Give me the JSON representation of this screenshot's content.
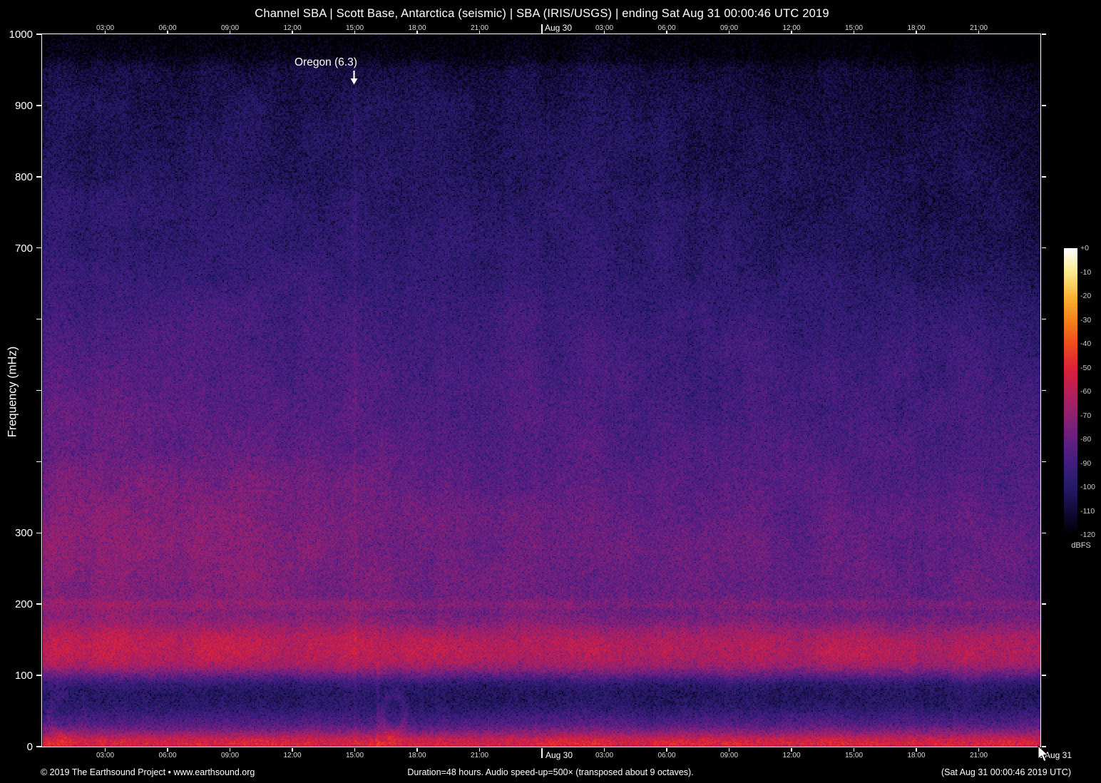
{
  "header": {
    "title": "Channel SBA | Scott Base, Antarctica (seismic) | SBA (IRIS/USGS) | ending Sat Aug 31 00:00:46 UTC 2019"
  },
  "annotation": {
    "label": "Oregon (6.3)"
  },
  "footer": {
    "left": "© 2019 The Earthsound Project • www.earthsound.org",
    "center": "Duration=48 hours. Audio speed-up=500× (transposed about 9 octaves).",
    "right": "(Sat Aug 31 00:00:46 2019 UTC)"
  },
  "chart_data": {
    "type": "heatmap",
    "title": "Channel SBA | Scott Base, Antarctica (seismic) | SBA (IRIS/USGS) | ending Sat Aug 31 00:00:46 UTC 2019",
    "ylabel": "Frequency (mHz)",
    "ylim": [
      0,
      1000
    ],
    "y_tick_step_mhz": 100,
    "y_ticks_labeled_mhz": [
      1000,
      900,
      800,
      700,
      300,
      200,
      100,
      0
    ],
    "x_axis": {
      "duration_hours": 48,
      "ticks": [
        {
          "hour": 3,
          "label": "03:00"
        },
        {
          "hour": 6,
          "label": "06:00"
        },
        {
          "hour": 9,
          "label": "09:00"
        },
        {
          "hour": 12,
          "label": "12:00"
        },
        {
          "hour": 15,
          "label": "15:00"
        },
        {
          "hour": 18,
          "label": "18:00"
        },
        {
          "hour": 21,
          "label": "21:00"
        },
        {
          "hour": 24,
          "label": "Aug 30",
          "day_boundary": true
        },
        {
          "hour": 27,
          "label": "03:00"
        },
        {
          "hour": 30,
          "label": "06:00"
        },
        {
          "hour": 33,
          "label": "09:00"
        },
        {
          "hour": 36,
          "label": "12:00"
        },
        {
          "hour": 39,
          "label": "15:00"
        },
        {
          "hour": 42,
          "label": "18:00"
        },
        {
          "hour": 45,
          "label": "21:00"
        }
      ],
      "bottom_end_tick": {
        "hour": 48,
        "label": "Aug 31",
        "day_boundary": true
      }
    },
    "colorbar": {
      "unit": "dBFS",
      "max_db": 0,
      "min_db": -120,
      "tick_labels": [
        "+0",
        "-10",
        "-20",
        "-30",
        "-40",
        "-50",
        "-60",
        "-70",
        "-80",
        "-90",
        "-100",
        "-110",
        "-120"
      ],
      "colormap": [
        {
          "db": 0,
          "hex": "#ffffff"
        },
        {
          "db": -10,
          "hex": "#fdeb8e"
        },
        {
          "db": -20,
          "hex": "#fbb733"
        },
        {
          "db": -30,
          "hex": "#f8821a"
        },
        {
          "db": -40,
          "hex": "#ee4e1d"
        },
        {
          "db": -50,
          "hex": "#dc2338"
        },
        {
          "db": -60,
          "hex": "#b81e58"
        },
        {
          "db": -70,
          "hex": "#8f2173"
        },
        {
          "db": -80,
          "hex": "#651f81"
        },
        {
          "db": -90,
          "hex": "#421d80"
        },
        {
          "db": -100,
          "hex": "#261a68"
        },
        {
          "db": -110,
          "hex": "#120b3a"
        },
        {
          "db": -120,
          "hex": "#000003"
        }
      ]
    },
    "frequency_profile_db": [
      {
        "mhz": 1000,
        "db": -119
      },
      {
        "mhz": 970,
        "db": -116
      },
      {
        "mhz": 950,
        "db": -108
      },
      {
        "mhz": 900,
        "db": -104
      },
      {
        "mhz": 800,
        "db": -101
      },
      {
        "mhz": 700,
        "db": -97
      },
      {
        "mhz": 600,
        "db": -92
      },
      {
        "mhz": 500,
        "db": -89
      },
      {
        "mhz": 400,
        "db": -85
      },
      {
        "mhz": 300,
        "db": -80
      },
      {
        "mhz": 250,
        "db": -79
      },
      {
        "mhz": 210,
        "db": -79
      },
      {
        "mhz": 203,
        "db": -74
      },
      {
        "mhz": 196,
        "db": -74
      },
      {
        "mhz": 189,
        "db": -78
      },
      {
        "mhz": 175,
        "db": -74
      },
      {
        "mhz": 160,
        "db": -66
      },
      {
        "mhz": 148,
        "db": -62
      },
      {
        "mhz": 135,
        "db": -61
      },
      {
        "mhz": 122,
        "db": -63
      },
      {
        "mhz": 112,
        "db": -68
      },
      {
        "mhz": 103,
        "db": -78
      },
      {
        "mhz": 95,
        "db": -88
      },
      {
        "mhz": 88,
        "db": -96
      },
      {
        "mhz": 80,
        "db": -100
      },
      {
        "mhz": 72,
        "db": -101
      },
      {
        "mhz": 60,
        "db": -100
      },
      {
        "mhz": 50,
        "db": -96
      },
      {
        "mhz": 42,
        "db": -91
      },
      {
        "mhz": 33,
        "db": -86
      },
      {
        "mhz": 25,
        "db": -78
      },
      {
        "mhz": 18,
        "db": -68
      },
      {
        "mhz": 10,
        "db": -55
      },
      {
        "mhz": 4,
        "db": -51
      },
      {
        "mhz": 0,
        "db": -53
      }
    ],
    "events": [
      {
        "label": "Oregon (6.3)",
        "magnitude": 6.3,
        "hour": 15
      }
    ]
  }
}
